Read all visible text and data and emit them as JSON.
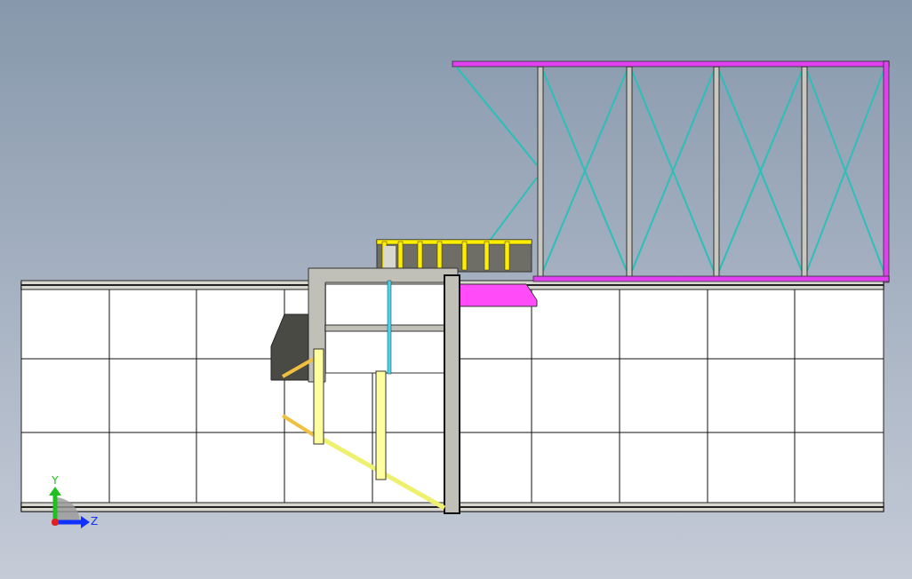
{
  "viewport": {
    "triad": {
      "axes": [
        {
          "kind": "y",
          "label": "Y"
        },
        {
          "kind": "z",
          "label": "Z"
        }
      ]
    }
  }
}
